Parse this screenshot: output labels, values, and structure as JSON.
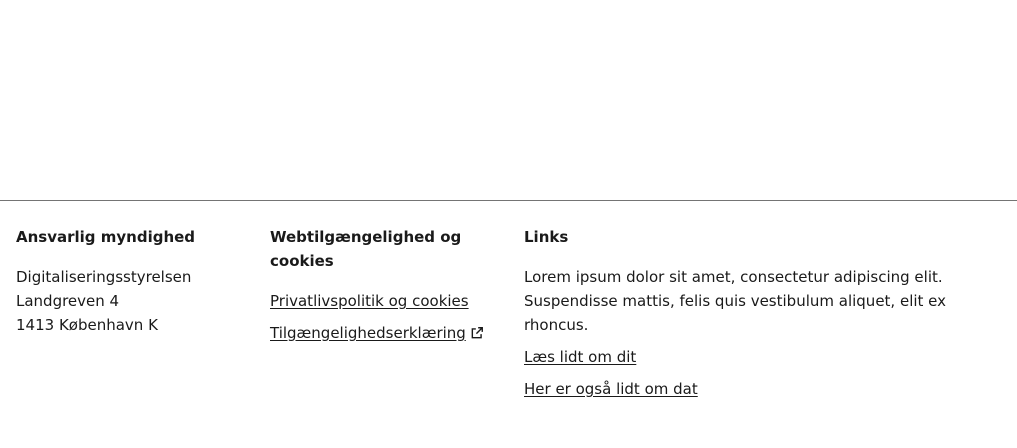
{
  "footer": {
    "authority": {
      "heading": "Ansvarlig myndighed",
      "address": [
        "Digitaliseringsstyrelsen",
        "Landgreven 4",
        "1413 København K"
      ]
    },
    "accessibility": {
      "heading": "Webtilgængelighed og cookies",
      "links": [
        {
          "label": "Privatlivspolitik og cookies",
          "external": false
        },
        {
          "label": "Tilgængelighedserklæring",
          "external": true
        }
      ]
    },
    "links": {
      "heading": "Links",
      "text": "Lorem ipsum dolor sit amet, consectetur adipiscing elit. Suspendisse mattis, felis quis vestibulum aliquet, elit ex rhoncus.",
      "items": [
        {
          "label": "Læs lidt om dit"
        },
        {
          "label": "Her er også lidt om dat"
        }
      ]
    },
    "icons": {
      "external": "external-link-icon"
    },
    "colors": {
      "divider": "#747474",
      "text": "#1a1a1a"
    }
  }
}
